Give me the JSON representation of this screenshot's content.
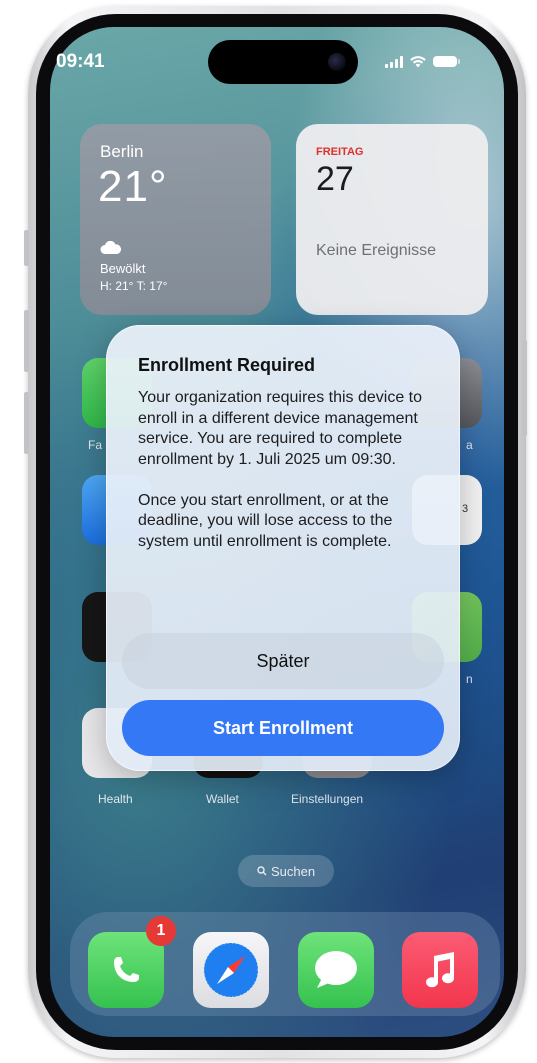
{
  "status_bar": {
    "time": "09:41"
  },
  "widgets": {
    "weather": {
      "city": "Berlin",
      "temperature": "21°",
      "condition": "Bewölkt",
      "high_low": "H: 21° T: 17°",
      "icon": "cloud-icon"
    },
    "calendar": {
      "weekday": "FREITAG",
      "day": "27",
      "events_text": "Keine Ereignisse"
    }
  },
  "background_apps": {
    "fa_fragment": "Fa",
    "a_fragment": "a",
    "n_fragment": "n",
    "clock_numeral": "3",
    "health": "Health",
    "wallet": "Wallet",
    "settings": "Einstellungen"
  },
  "alert": {
    "title": "Enrollment Required",
    "body": "Your organization requires this device to enroll in a different device management service. You are required to complete enrollment by 1. Juli 2025 um 09:30.\n\nOnce you start enrollment, or at the deadline, you will lose access to the system until enrollment is complete.",
    "secondary_button": "Später",
    "primary_button": "Start Enrollment"
  },
  "search": {
    "label": "Suchen",
    "icon": "search-icon"
  },
  "dock": {
    "phone_badge": "1",
    "apps": [
      "phone-icon",
      "safari-icon",
      "messages-icon",
      "music-icon"
    ]
  },
  "colors": {
    "accent_blue": "#3478f6",
    "badge_red": "#e53935",
    "calendar_red": "#e0302a"
  }
}
